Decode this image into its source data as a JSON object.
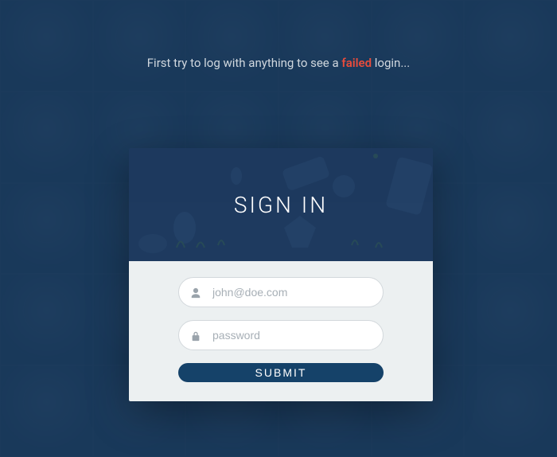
{
  "hint": {
    "prefix": "First try to log with anything to see a ",
    "highlight": "failed",
    "suffix": " login..."
  },
  "card": {
    "title": "SIGN IN",
    "email": {
      "placeholder": "john@doe.com",
      "value": ""
    },
    "password": {
      "placeholder": "password",
      "value": ""
    },
    "submit_label": "SUBMIT"
  },
  "colors": {
    "accent": "#154269",
    "danger": "#e74c3c",
    "bg": "#1a3a5c"
  }
}
